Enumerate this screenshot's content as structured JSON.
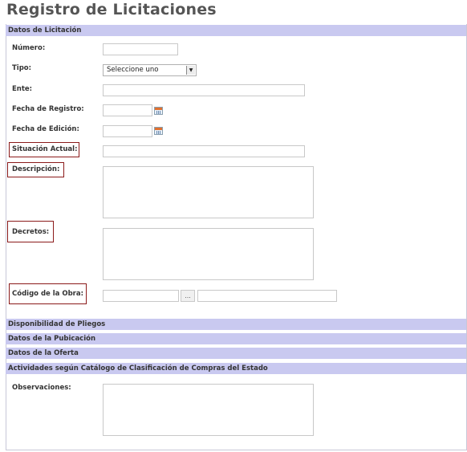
{
  "page_title": "Registro de Licitaciones",
  "sections": {
    "datos_licitacion": "Datos de Licitación",
    "disponibilidad": "Disponibilidad de Pliegos",
    "publicacion": "Datos de la Pubicación",
    "oferta": "Datos de la Oferta",
    "actividades": "Actividades según Catálogo de Clasificación de Compras del Estado"
  },
  "fields": {
    "numero": "Número:",
    "tipo": "Tipo:",
    "tipo_selected": "Seleccione uno",
    "ente": "Ente:",
    "fecha_registro": "Fecha de Registro:",
    "fecha_edicion": "Fecha de Edición:",
    "situacion_actual": "Situación Actual:",
    "descripcion": "Descripción:",
    "decretos": "Decretos:",
    "codigo_obra": "Código de la Obra:",
    "codigo_obra_button": "...",
    "observaciones": "Observaciones:"
  },
  "icons": {
    "calendar": "calendar-icon",
    "dropdown": "chevron-down-icon"
  },
  "colors": {
    "section_bar": "#c9c9f0",
    "highlight_border": "#8b1a1a"
  }
}
